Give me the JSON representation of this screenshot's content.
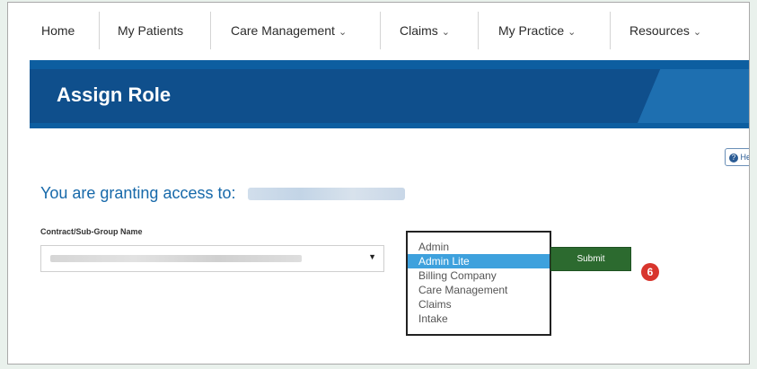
{
  "nav": {
    "items": [
      {
        "label": "Home",
        "dropdown": false
      },
      {
        "label": "My Patients",
        "dropdown": false
      },
      {
        "label": "Care Management",
        "dropdown": true
      },
      {
        "label": "Claims",
        "dropdown": true
      },
      {
        "label": "My Practice",
        "dropdown": true
      },
      {
        "label": "Resources",
        "dropdown": true
      }
    ]
  },
  "banner": {
    "title": "Assign Role"
  },
  "help": {
    "label": "He"
  },
  "access": {
    "prefix": "You are granting access to:"
  },
  "contract": {
    "label": "Contract/Sub-Group Name"
  },
  "roles": {
    "options": [
      "Admin",
      "Admin Lite",
      "Billing Company",
      "Care Management",
      "Claims",
      "Intake"
    ],
    "selected": "Admin Lite"
  },
  "submit": {
    "label": "Submit"
  },
  "step_badge": {
    "label": "6"
  },
  "colors": {
    "banner": "#0f4f8c",
    "accent": "#1769aa",
    "submit": "#2c6a2f",
    "badge": "#d8352d",
    "selected": "#3ea1dd"
  }
}
